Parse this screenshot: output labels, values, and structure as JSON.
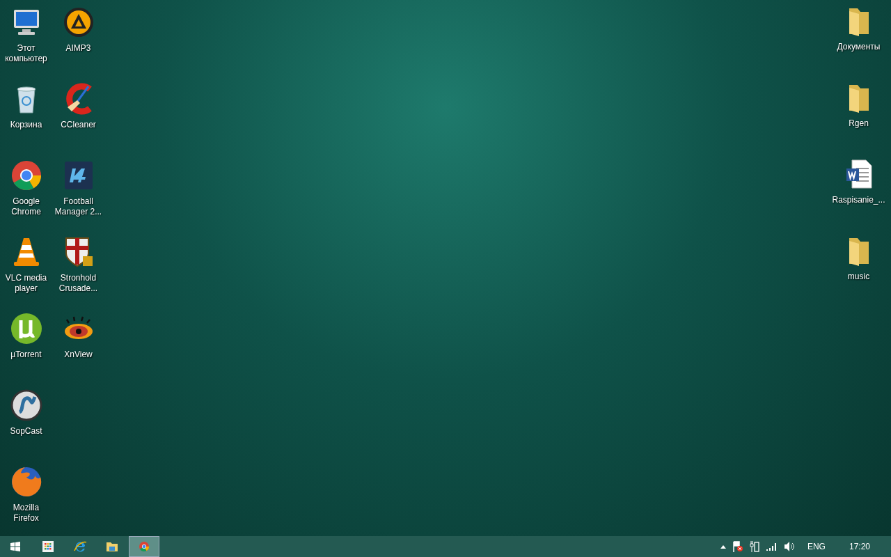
{
  "desktop": {
    "left_columns": [
      [
        {
          "label": "Этот компьютер",
          "kind": "computer"
        },
        {
          "label": "Корзина",
          "kind": "bin"
        },
        {
          "label": "Google Chrome",
          "kind": "chrome"
        },
        {
          "label": "VLC media player",
          "kind": "cone"
        },
        {
          "label": "µTorrent",
          "kind": "torrent"
        },
        {
          "label": "SopCast",
          "kind": "disc"
        },
        {
          "label": "Mozilla Firefox",
          "kind": "firefox"
        }
      ],
      [
        {
          "label": "AIMP3",
          "kind": "player"
        },
        {
          "label": "CCleaner",
          "kind": "cleaner"
        },
        {
          "label": "Football Manager 2...",
          "kind": "tile"
        },
        {
          "label": "Stronhold Crusade...",
          "kind": "shield"
        },
        {
          "label": "XnView",
          "kind": "eye"
        }
      ]
    ],
    "right_column": [
      {
        "label": "Документы",
        "kind": "folder"
      },
      {
        "label": "Rgen",
        "kind": "folder"
      },
      {
        "label": "Raspisanie_...",
        "kind": "document"
      },
      {
        "label": "music",
        "kind": "folder"
      }
    ]
  },
  "taskbar": {
    "items": [
      {
        "kind": "start",
        "selected": false
      },
      {
        "kind": "store",
        "selected": false
      },
      {
        "kind": "browser",
        "selected": false
      },
      {
        "kind": "explorer",
        "selected": false
      },
      {
        "kind": "chrome",
        "selected": true
      }
    ],
    "tray": {
      "language": "ENG",
      "time": "17:20"
    }
  }
}
